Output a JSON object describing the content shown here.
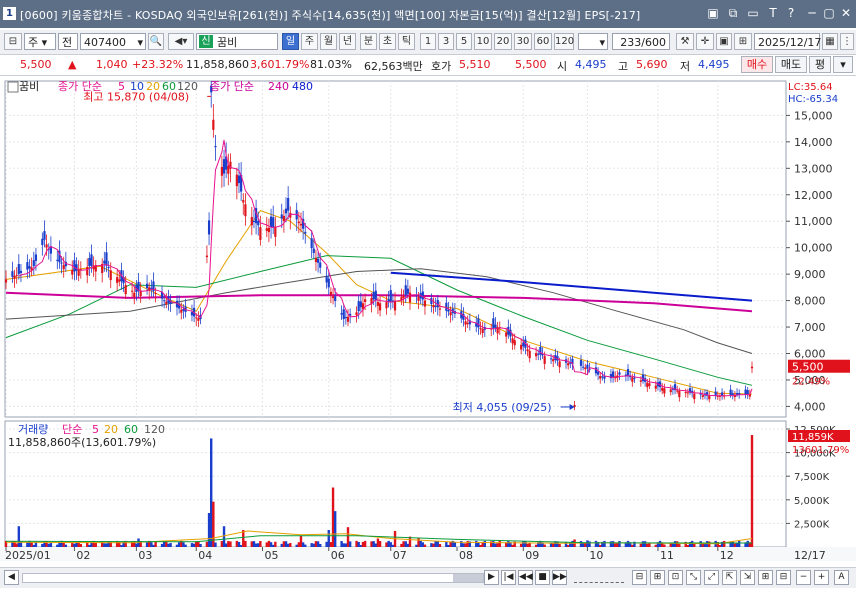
{
  "window": {
    "number": "1",
    "title": "[0600] 키움종합차트 - KOSDAQ 외국인보유[261(천)] 주식수[14,635(천)] 액면[100] 자본금[15(억)] 결산[12월] EPS[-217]",
    "controls": [
      "▣",
      "⧉",
      "▭",
      "T",
      "?",
      "─",
      "▢",
      "✕"
    ]
  },
  "toolbar": {
    "item_type": "주",
    "exchange": "전",
    "code": "407400",
    "market_badge": "신",
    "stock_name": "꿈비",
    "periods": [
      "일",
      "주",
      "월",
      "년",
      "분",
      "초",
      "틱"
    ],
    "selected_period": "일",
    "ticks": [
      "1",
      "3",
      "5",
      "10",
      "20",
      "30",
      "60",
      "120"
    ],
    "count": "233",
    "count_total": "/600",
    "date": "2025/12/17"
  },
  "quote": {
    "price": "5,500",
    "change_arrow": "▲",
    "change": "1,040",
    "change_pct": "+23.32%",
    "volume": "11,858,860",
    "volume_pct": "3,601.79%",
    "rate": "81.03%",
    "amount": "62,563백만",
    "hoga_label": "호가",
    "ask": "5,510",
    "bid": "5,500",
    "open_label": "시",
    "open": "4,495",
    "high_label": "고",
    "high": "5,690",
    "low_label": "저",
    "low": "4,495",
    "buy_button": "매수",
    "sell_button": "매도",
    "eval_button": "평"
  },
  "chart_data": [
    {
      "type": "candlestick",
      "legend": {
        "name": "꿈비",
        "ma_label": "종가 단순",
        "ma_periods": [
          "5",
          "10",
          "20",
          "60",
          "120"
        ],
        "ma_label2": "종가 단순",
        "ma_periods2": [
          "240",
          "480"
        ],
        "ma_colors": [
          "#e6138f",
          "#1a3ecc",
          "#e5a000",
          "#0a9b3b",
          "#555555",
          "#cc0099",
          "#0a1ccc"
        ]
      },
      "right_labels": {
        "lc": "LC:35.64",
        "hc": "HC:-65.34"
      },
      "y_ticks": [
        "15,000",
        "14,000",
        "13,000",
        "12,000",
        "11,000",
        "10,000",
        "9,000",
        "8,000",
        "7,000",
        "6,000",
        "5,000",
        "4,000"
      ],
      "ylim": [
        3600,
        16300
      ],
      "x_ticks": [
        "2025/01",
        "02",
        "03",
        "04",
        "05",
        "06",
        "07",
        "08",
        "09",
        "10",
        "11",
        "12"
      ],
      "x_right": "12/17",
      "annotations": [
        {
          "text": "최고 15,870 (04/08)",
          "date": "04/08",
          "value": 15870
        },
        {
          "text": "최저 4,055 (09/25)",
          "date": "09/25",
          "value": 4055
        }
      ],
      "last_price_label": "5,500",
      "last_pct_label": "22.49%",
      "close_path": [
        [
          "01/02",
          8800
        ],
        [
          "01/08",
          9000
        ],
        [
          "01/15",
          9300
        ],
        [
          "01/20",
          10300
        ],
        [
          "01/24",
          9600
        ],
        [
          "02/03",
          9100
        ],
        [
          "02/10",
          9300
        ],
        [
          "02/17",
          9400
        ],
        [
          "02/24",
          8800
        ],
        [
          "03/03",
          8300
        ],
        [
          "03/10",
          8500
        ],
        [
          "03/17",
          8000
        ],
        [
          "03/24",
          7700
        ],
        [
          "03/31",
          7400
        ],
        [
          "04/03",
          7300
        ],
        [
          "04/07",
          10500
        ],
        [
          "04/08",
          15870
        ],
        [
          "04/10",
          13800
        ],
        [
          "04/14",
          12800
        ],
        [
          "04/18",
          13400
        ],
        [
          "04/23",
          11800
        ],
        [
          "04/28",
          11000
        ],
        [
          "05/02",
          10700
        ],
        [
          "05/08",
          10800
        ],
        [
          "05/14",
          11400
        ],
        [
          "05/20",
          10900
        ],
        [
          "05/26",
          9800
        ],
        [
          "06/02",
          8500
        ],
        [
          "06/09",
          7300
        ],
        [
          "06/16",
          7600
        ],
        [
          "06/20",
          8200
        ],
        [
          "06/26",
          7900
        ],
        [
          "07/03",
          8000
        ],
        [
          "07/10",
          8300
        ],
        [
          "07/17",
          8000
        ],
        [
          "07/24",
          7700
        ],
        [
          "07/31",
          7500
        ],
        [
          "08/07",
          7100
        ],
        [
          "08/14",
          6900
        ],
        [
          "08/21",
          7000
        ],
        [
          "08/28",
          6500
        ],
        [
          "09/04",
          6100
        ],
        [
          "09/11",
          5900
        ],
        [
          "09/18",
          5700
        ],
        [
          "09/24",
          5600
        ],
        [
          "09/25",
          4055
        ],
        [
          "09/26",
          5600
        ],
        [
          "10/02",
          5400
        ],
        [
          "10/10",
          5000
        ],
        [
          "10/16",
          5200
        ],
        [
          "10/22",
          5100
        ],
        [
          "10/29",
          4900
        ],
        [
          "11/05",
          4700
        ],
        [
          "11/12",
          4600
        ],
        [
          "11/19",
          4500
        ],
        [
          "11/26",
          4400
        ],
        [
          "12/03",
          4400
        ],
        [
          "12/10",
          4450
        ],
        [
          "12/16",
          4460
        ],
        [
          "12/17",
          5500
        ]
      ],
      "series": [
        {
          "period": "5",
          "color": "#e6138f"
        },
        {
          "period": "20",
          "color": "#e5a000",
          "values": [
            [
              "01/02",
              8800
            ],
            [
              "02/15",
              9300
            ],
            [
              "03/15",
              8200
            ],
            [
              "04/01",
              7600
            ],
            [
              "04/15",
              9500
            ],
            [
              "05/01",
              11400
            ],
            [
              "05/15",
              11000
            ],
            [
              "06/01",
              9800
            ],
            [
              "06/15",
              8600
            ],
            [
              "07/01",
              8000
            ],
            [
              "08/01",
              7700
            ],
            [
              "09/01",
              6500
            ],
            [
              "10/01",
              5700
            ],
            [
              "11/01",
              5100
            ],
            [
              "12/01",
              4500
            ],
            [
              "12/17",
              4470
            ]
          ]
        },
        {
          "period": "60",
          "color": "#0a9b3b",
          "values": [
            [
              "01/02",
              6600
            ],
            [
              "02/01",
              7500
            ],
            [
              "03/01",
              8600
            ],
            [
              "04/01",
              8500
            ],
            [
              "05/01",
              9100
            ],
            [
              "06/01",
              9700
            ],
            [
              "07/01",
              9600
            ],
            [
              "08/01",
              8400
            ],
            [
              "09/01",
              7400
            ],
            [
              "10/01",
              6500
            ],
            [
              "11/01",
              5800
            ],
            [
              "12/01",
              5100
            ],
            [
              "12/17",
              4800
            ]
          ]
        },
        {
          "period": "120",
          "color": "#555555",
          "values": [
            [
              "01/02",
              7300
            ],
            [
              "03/01",
              7600
            ],
            [
              "04/15",
              8300
            ],
            [
              "05/15",
              8700
            ],
            [
              "06/15",
              9100
            ],
            [
              "07/15",
              9200
            ],
            [
              "08/15",
              8900
            ],
            [
              "09/15",
              8300
            ],
            [
              "10/15",
              7600
            ],
            [
              "11/15",
              6900
            ],
            [
              "12/01",
              6400
            ],
            [
              "12/17",
              6000
            ]
          ]
        },
        {
          "period": "240",
          "color": "#cc0099",
          "values": [
            [
              "01/02",
              8300
            ],
            [
              "03/01",
              8100
            ],
            [
              "05/01",
              8200
            ],
            [
              "07/01",
              8200
            ],
            [
              "09/01",
              8100
            ],
            [
              "11/01",
              7900
            ],
            [
              "12/17",
              7600
            ]
          ]
        },
        {
          "period": "480",
          "color": "#0a1ccc",
          "values": [
            [
              "07/01",
              9050
            ],
            [
              "09/01",
              8700
            ],
            [
              "11/01",
              8300
            ],
            [
              "12/17",
              8000
            ]
          ]
        }
      ]
    },
    {
      "type": "bar",
      "legend": {
        "name": "거래량",
        "ma_label": "단순",
        "ma_periods": [
          "5",
          "20",
          "60",
          "120"
        ],
        "ma_colors": [
          "#e6138f",
          "#e5a000",
          "#0a9b3b",
          "#555555"
        ]
      },
      "info": "11,858,860주(13,601.79%)",
      "y_ticks": [
        "12,500K",
        "10,000K",
        "7,500K",
        "5,000K",
        "2,500K"
      ],
      "ylim": [
        0,
        12500000
      ],
      "right_labels": {
        "volume": "11,859K",
        "pct": "13601.79%"
      },
      "spikes": [
        [
          "01/08",
          2200000
        ],
        [
          "03/05",
          900000
        ],
        [
          "03/28",
          1000000
        ],
        [
          "04/07",
          3600000
        ],
        [
          "04/08",
          11500000
        ],
        [
          "04/09",
          4800000
        ],
        [
          "04/11",
          3000000
        ],
        [
          "04/14",
          2200000
        ],
        [
          "04/23",
          1800000
        ],
        [
          "05/02",
          1800000
        ],
        [
          "05/20",
          1200000
        ],
        [
          "06/02",
          1800000
        ],
        [
          "06/04",
          6300000
        ],
        [
          "06/05",
          3800000
        ],
        [
          "06/11",
          2100000
        ],
        [
          "06/25",
          900000
        ],
        [
          "07/03",
          1700000
        ],
        [
          "07/10",
          1100000
        ],
        [
          "07/14",
          900000
        ],
        [
          "09/25",
          800000
        ],
        [
          "09/26",
          1500000
        ],
        [
          "10/01",
          700000
        ],
        [
          "12/17",
          11858860
        ]
      ]
    }
  ],
  "navigation": {
    "buttons": [
      "◀",
      "▶",
      "|◀",
      "◀◀",
      "■",
      "▶▶",
      "−",
      "+",
      "A"
    ],
    "zoom_icons": [
      "⊟",
      "⊞",
      "⊡",
      "⤡",
      "⤢",
      "⇱",
      "⇲",
      "⊞",
      "⊟"
    ]
  }
}
